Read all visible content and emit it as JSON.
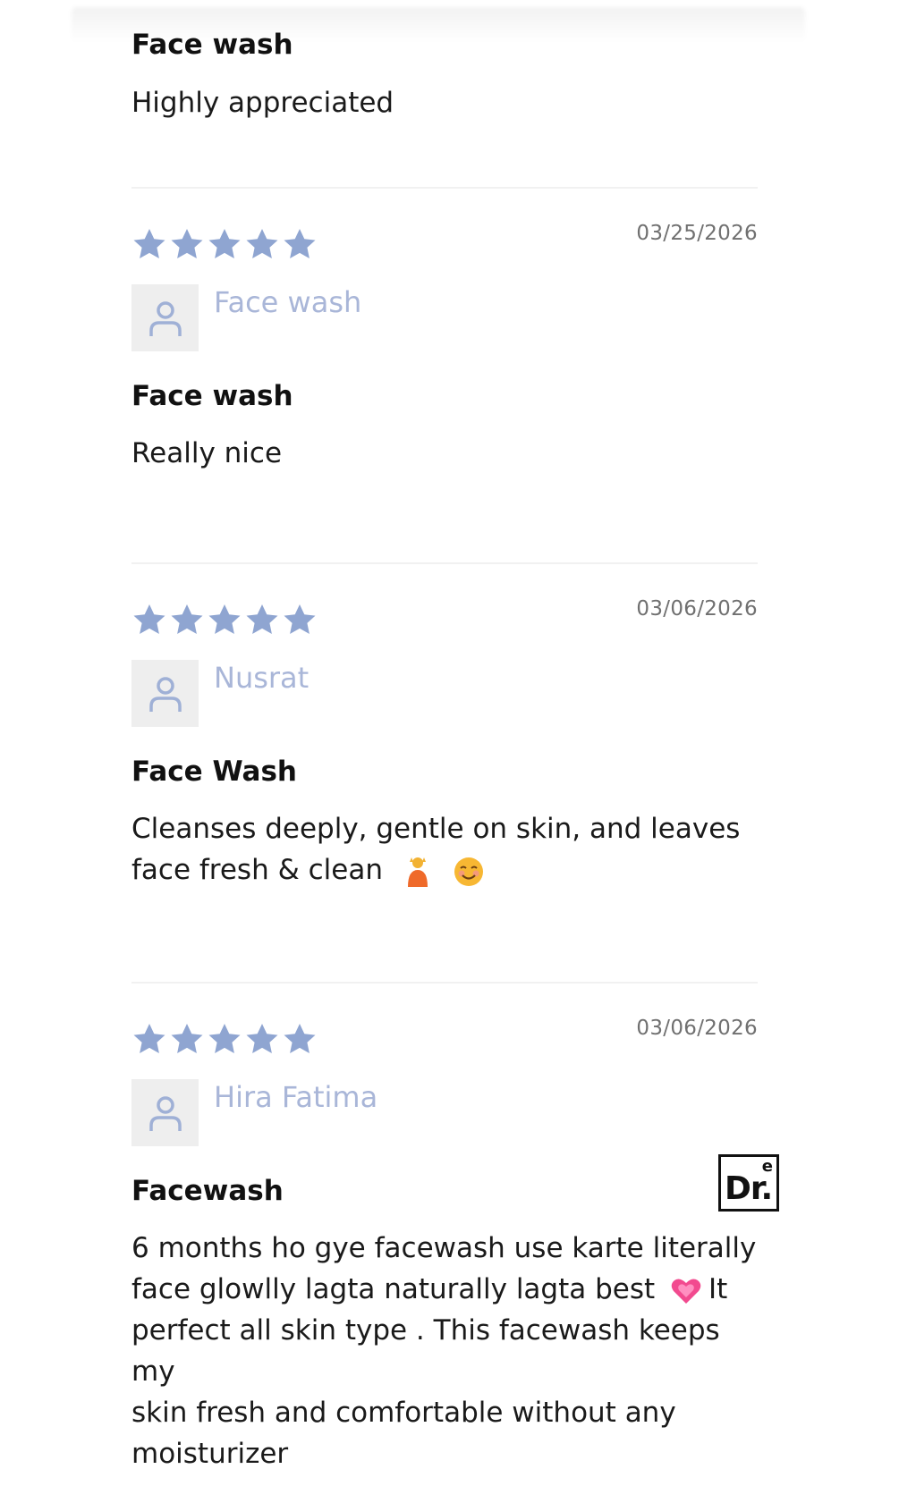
{
  "colors": {
    "star": "#8fa5d1",
    "author_name": "#a9b6d8",
    "date": "#707070",
    "avatar_bg": "#eeeeee",
    "avatar_icon": "#9fb0d6",
    "divider": "#f1f1f1"
  },
  "reviews": [
    {
      "title": "Face wash",
      "body": "Highly appreciated"
    },
    {
      "rating": 5,
      "date": "03/25/2026",
      "author": "Face wash",
      "title": "Face wash",
      "body": "Really nice"
    },
    {
      "rating": 5,
      "date": "03/06/2026",
      "author": "Nusrat",
      "title": "Face Wash",
      "body_line1": "Cleanses deeply, gentle on skin, and leaves",
      "body_line2": "face fresh & clean",
      "emojis": [
        "person-icon",
        "smiling-face-icon"
      ]
    },
    {
      "rating": 5,
      "date": "03/06/2026",
      "author": "Hira Fatima",
      "title": "Facewash",
      "body_line1": "6 months ho gye facewash use karte literally",
      "body_line2a": "face glowlly lagta naturally lagta best",
      "body_line2b": "It",
      "body_line3": "perfect all skin type . This facewash keeps my",
      "body_line4": "skin fresh and comfortable without any",
      "body_line5": "moisturizer",
      "emojis": [
        "heart-icon"
      ]
    }
  ],
  "watermark": {
    "main": "Dr.",
    "sup": "e"
  }
}
